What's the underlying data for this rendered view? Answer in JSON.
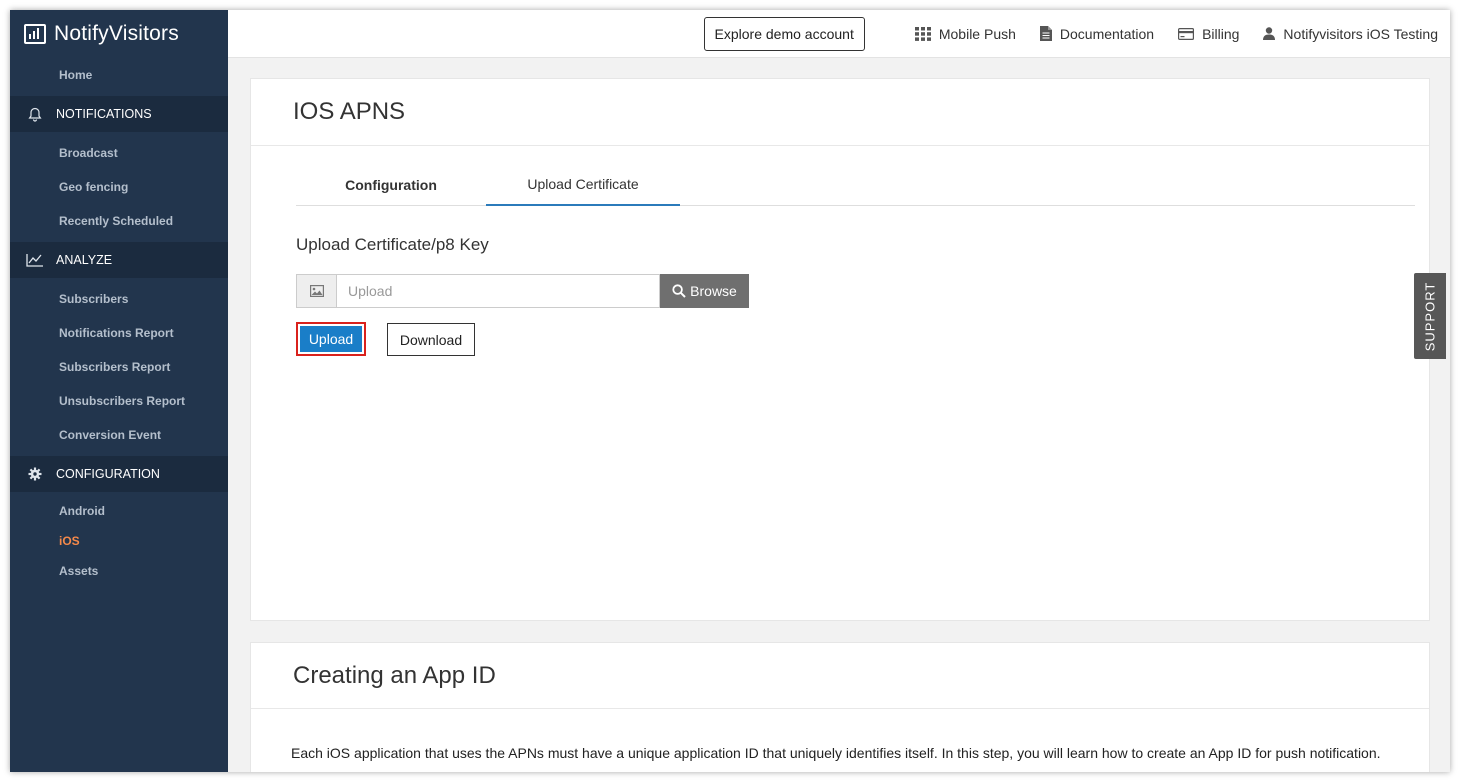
{
  "app": {
    "brand": "NotifyVisitors"
  },
  "sidebar": {
    "home": "Home",
    "sections": [
      {
        "title": "NOTIFICATIONS",
        "icon": "bell-icon",
        "items": [
          "Broadcast",
          "Geo fencing",
          "Recently Scheduled"
        ]
      },
      {
        "title": "ANALYZE",
        "icon": "chart-line-icon",
        "items": [
          "Subscribers",
          "Notifications Report",
          "Subscribers Report",
          "Unsubscribers Report",
          "Conversion Event"
        ]
      },
      {
        "title": "CONFIGURATION",
        "icon": "gear-icon",
        "items": [
          "Android",
          "iOS",
          "Assets"
        ]
      }
    ],
    "active_item": "iOS"
  },
  "topbar": {
    "demo_button": "Explore demo account",
    "mobile_push": "Mobile Push",
    "documentation": "Documentation",
    "billing": "Billing",
    "account": "Notifyvisitors iOS Testing"
  },
  "main": {
    "title": "IOS APNS",
    "tabs": [
      {
        "label": "Configuration",
        "active": false
      },
      {
        "label": "Upload Certificate",
        "active": true
      }
    ],
    "section_label": "Upload Certificate/p8 Key",
    "upload_placeholder": "Upload",
    "browse_label": "Browse",
    "upload_button": "Upload",
    "download_button": "Download"
  },
  "card2": {
    "title": "Creating an App ID",
    "text": "Each iOS application that uses the APNs must have a unique application ID that uniquely identifies itself. In this step, you will learn how to create an App ID for push notification."
  },
  "support": {
    "label": "SUPPORT"
  },
  "colors": {
    "sidebar_bg": "#22354d",
    "section_bg": "#1b2b3f",
    "active_item": "#f5894a",
    "primary": "#1a7ec8",
    "highlight_border": "#d9211c",
    "tab_underline": "#2b7bbb"
  }
}
